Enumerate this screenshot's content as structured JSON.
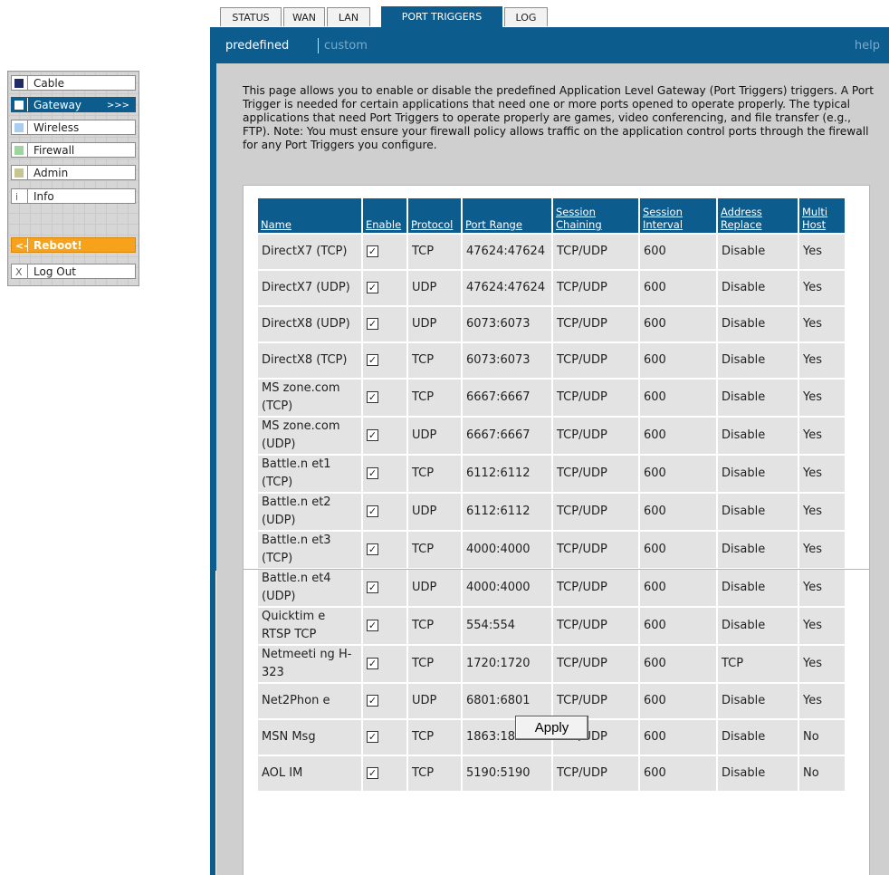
{
  "nav": {
    "items": [
      {
        "label": "Cable",
        "color": "#222a66"
      },
      {
        "label": "Gateway",
        "color": "#ffffff",
        "arrow": ">>>"
      },
      {
        "label": "Wireless",
        "color": "#a8cff0"
      },
      {
        "label": "Firewall",
        "color": "#9ed49e"
      },
      {
        "label": "Admin",
        "color": "#c6c690"
      },
      {
        "label": "Info",
        "icon": "i"
      },
      {
        "label": "Reboot!",
        "icon": "<-"
      },
      {
        "label": "Log Out",
        "icon": "X"
      }
    ]
  },
  "tabs": [
    "STATUS",
    "WAN",
    "LAN",
    "PORT TRIGGERS",
    "LOG"
  ],
  "subnav": {
    "predefined": "predefined",
    "custom": "custom",
    "help": "help"
  },
  "intro": "This page allows you to enable or disable the predefined Application Level Gateway (Port Triggers) triggers. A Port Trigger is needed for certain applications that need one or more ports opened to operate properly. The typical applications that need Port Triggers to operate properly are games, video conferencing, and file transfer (e.g., FTP). Note: You must ensure your firewall policy allows traffic on the application control ports through the firewall for any Port Triggers you configure.",
  "table": {
    "headers": [
      "Name",
      "Enable",
      "Protocol",
      "Port Range",
      "Session Chaining",
      "Session Interval",
      "Address Replace",
      "Multi Host"
    ],
    "rows": [
      {
        "name": "DirectX7 (TCP)",
        "enable": "✓",
        "protocol": "TCP",
        "range": "47624:47624",
        "chaining": "TCP/UDP",
        "interval": "600",
        "replace": "Disable",
        "multi": "Yes"
      },
      {
        "name": "DirectX7 (UDP)",
        "enable": "✓",
        "protocol": "UDP",
        "range": "47624:47624",
        "chaining": "TCP/UDP",
        "interval": "600",
        "replace": "Disable",
        "multi": "Yes"
      },
      {
        "name": "DirectX8 (UDP)",
        "enable": "✓",
        "protocol": "UDP",
        "range": "6073:6073",
        "chaining": "TCP/UDP",
        "interval": "600",
        "replace": "Disable",
        "multi": "Yes"
      },
      {
        "name": "DirectX8 (TCP)",
        "enable": "✓",
        "protocol": "TCP",
        "range": "6073:6073",
        "chaining": "TCP/UDP",
        "interval": "600",
        "replace": "Disable",
        "multi": "Yes"
      },
      {
        "name": "MS zone.com (TCP)",
        "enable": "✓",
        "protocol": "TCP",
        "range": "6667:6667",
        "chaining": "TCP/UDP",
        "interval": "600",
        "replace": "Disable",
        "multi": "Yes"
      },
      {
        "name": "MS zone.com (UDP)",
        "enable": "✓",
        "protocol": "UDP",
        "range": "6667:6667",
        "chaining": "TCP/UDP",
        "interval": "600",
        "replace": "Disable",
        "multi": "Yes"
      },
      {
        "name": "Battle.n et1 (TCP)",
        "enable": "✓",
        "protocol": "TCP",
        "range": "6112:6112",
        "chaining": "TCP/UDP",
        "interval": "600",
        "replace": "Disable",
        "multi": "Yes"
      },
      {
        "name": "Battle.n et2 (UDP)",
        "enable": "✓",
        "protocol": "UDP",
        "range": "6112:6112",
        "chaining": "TCP/UDP",
        "interval": "600",
        "replace": "Disable",
        "multi": "Yes"
      },
      {
        "name": "Battle.n et3 (TCP)",
        "enable": "✓",
        "protocol": "TCP",
        "range": "4000:4000",
        "chaining": "TCP/UDP",
        "interval": "600",
        "replace": "Disable",
        "multi": "Yes"
      },
      {
        "name": "Battle.n et4 (UDP)",
        "enable": "✓",
        "protocol": "UDP",
        "range": "4000:4000",
        "chaining": "TCP/UDP",
        "interval": "600",
        "replace": "Disable",
        "multi": "Yes"
      },
      {
        "name": "Quicktim e RTSP TCP",
        "enable": "✓",
        "protocol": "TCP",
        "range": "554:554",
        "chaining": "TCP/UDP",
        "interval": "600",
        "replace": "Disable",
        "multi": "Yes"
      },
      {
        "name": "Netmeeti ng H-323",
        "enable": "✓",
        "protocol": "TCP",
        "range": "1720:1720",
        "chaining": "TCP/UDP",
        "interval": "600",
        "replace": "TCP",
        "multi": "Yes"
      },
      {
        "name": "Net2Phon e",
        "enable": "✓",
        "protocol": "UDP",
        "range": "6801:6801",
        "chaining": "TCP/UDP",
        "interval": "600",
        "replace": "Disable",
        "multi": "Yes"
      },
      {
        "name": "MSN Msg",
        "enable": "✓",
        "protocol": "TCP",
        "range": "1863:1863",
        "chaining": "TCP/UDP",
        "interval": "600",
        "replace": "Disable",
        "multi": "No"
      },
      {
        "name": "AOL IM",
        "enable": "✓",
        "protocol": "TCP",
        "range": "5190:5190",
        "chaining": "TCP/UDP",
        "interval": "600",
        "replace": "Disable",
        "multi": "No"
      }
    ]
  },
  "apply_label": "Apply",
  "colors": {
    "brand": "#0d5c8e",
    "panel": "#cfcfcf",
    "cell": "#e3e3e3",
    "reboot": "#f7a21b"
  }
}
